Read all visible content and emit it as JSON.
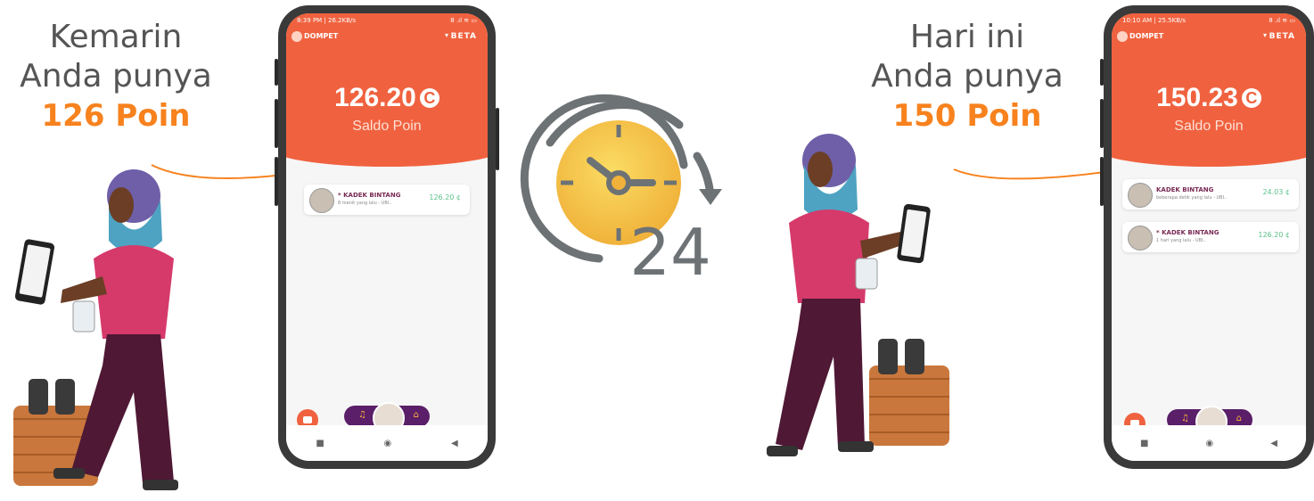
{
  "captions": {
    "left": {
      "line1": "Kemarin",
      "line2": "Anda punya",
      "highlight": "126 Poin"
    },
    "right": {
      "line1": "Hari ini",
      "line2": "Anda punya",
      "highlight": "150 Poin"
    }
  },
  "colors": {
    "accent": "#f0623f",
    "highlight": "#f7821e",
    "nav_pill": "#5a1f68",
    "positive": "#5bc08a",
    "clock_face": "#f6c23e",
    "clock_ring": "#6d7275"
  },
  "phone_left": {
    "status_time": "8:39 PM | 26.2KB/s",
    "status_icons": "8 .ıl ≋ ▭",
    "app_name": "DOMPET",
    "badge": "BETA",
    "balance": "126.20",
    "coin_symbol": "C",
    "balance_label": "Saldo Poin",
    "transactions": [
      {
        "name": "* KADEK BINTANG",
        "subtitle": "8 menit yang lalu - UBI..",
        "value": "126.20 ¢"
      }
    ]
  },
  "phone_right": {
    "status_time": "10:10 AM | 25.5KB/s",
    "status_icons": "8 .ıl ≋ ▭",
    "app_name": "DOMPET",
    "badge": "BETA",
    "balance": "150.23",
    "coin_symbol": "C",
    "balance_label": "Saldo Poin",
    "transactions": [
      {
        "name": "KADEK BINTANG",
        "subtitle": "beberapa detik yang lalu - UBI..",
        "value": "24.03 ¢"
      },
      {
        "name": "* KADEK BINTANG",
        "subtitle": "1 hari yang lalu - UBI..",
        "value": "126.20 ¢"
      }
    ]
  },
  "clock": {
    "label": "24",
    "icon": "clock-24h-icon"
  },
  "nav_icons": [
    "stop-square-icon",
    "home-circle-icon",
    "back-triangle-icon"
  ]
}
